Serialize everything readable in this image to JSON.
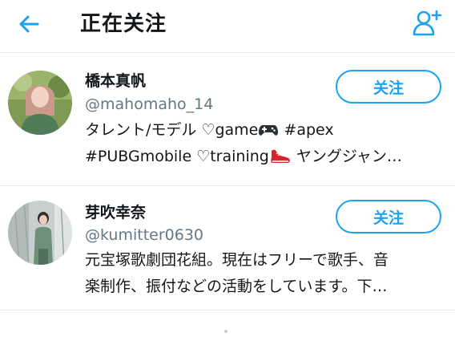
{
  "header": {
    "title": "正在关注",
    "back_icon": "arrow-left-icon",
    "add_icon": "add-user-icon",
    "accent": "#1da1f2"
  },
  "users": [
    {
      "name": "橋本真帆",
      "handle": "@mahomaho_14",
      "follow_label": "关注",
      "bio_line1_a": "タレント/モデル ♡game",
      "bio_line1_icon": "game-controller-icon",
      "bio_line1_b": " #apex",
      "bio_line2_a": "#PUBGmobile ♡training",
      "bio_line2_icon": "running-shoe-icon",
      "bio_line2_b": " ヤングジャン…"
    },
    {
      "name": "芽吹幸奈",
      "handle": "@kumitter0630",
      "follow_label": "关注",
      "bio_line1": "元宝塚歌劇団花組。現在はフリーで歌手、音",
      "bio_line2": "楽制作、振付などの活動をしています。下…"
    }
  ],
  "colors": {
    "text_primary": "#14171a",
    "text_secondary": "#657786",
    "divider": "#e6ecf0"
  }
}
